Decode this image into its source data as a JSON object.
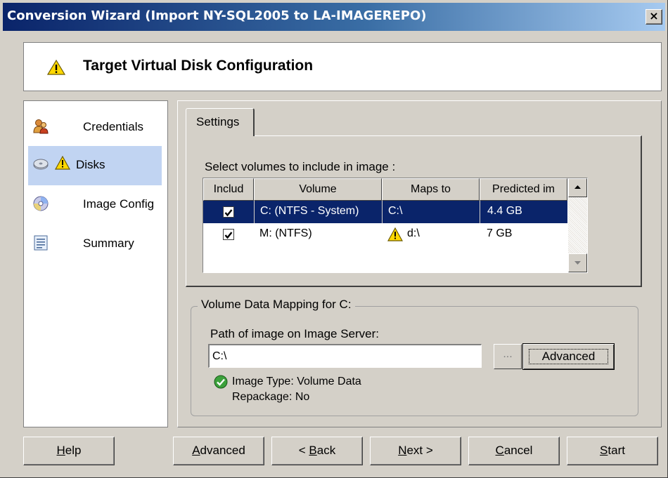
{
  "window": {
    "title": "Conversion Wizard (Import NY-SQL2005 to LA-IMAGEREPO)",
    "close_label": "×"
  },
  "header": {
    "title": "Target Virtual Disk Configuration",
    "icon": "warning-icon"
  },
  "nav": {
    "items": [
      {
        "label": "Credentials",
        "icon": "users-icon",
        "selected": false,
        "warning": false
      },
      {
        "label": "Disks",
        "icon": "disk-icon",
        "selected": true,
        "warning": true
      },
      {
        "label": "Image Config",
        "icon": "cd-icon",
        "selected": false,
        "warning": false
      },
      {
        "label": "Summary",
        "icon": "document-icon",
        "selected": false,
        "warning": false
      }
    ]
  },
  "tabs": [
    {
      "label": "Settings",
      "active": true
    }
  ],
  "volumes": {
    "caption": "Select volumes to include in image :",
    "columns": [
      "Includ",
      "Volume",
      "Maps to",
      "Predicted im"
    ],
    "rows": [
      {
        "included": true,
        "volume": "C: (NTFS - System)",
        "maps_to": "C:\\",
        "predicted": "4.4 GB",
        "selected": true,
        "warning": false
      },
      {
        "included": true,
        "volume": "M: (NTFS)",
        "maps_to": "d:\\",
        "predicted": "7 GB",
        "selected": false,
        "warning": true
      }
    ]
  },
  "mapping": {
    "group_label": "Volume Data Mapping for C:",
    "path_label": "Path of image on Image Server:",
    "path_value": "C:\\",
    "browse_label": "...",
    "advanced_label": "Advanced",
    "image_type": "Image Type: Volume Data",
    "repackage": "Repackage: No"
  },
  "buttons": {
    "help": {
      "pre": "",
      "key": "H",
      "post": "elp"
    },
    "advanced": {
      "pre": "",
      "key": "A",
      "post": "dvanced"
    },
    "back": {
      "pre": "< ",
      "key": "B",
      "post": "ack"
    },
    "next": {
      "pre": "",
      "key": "N",
      "post": "ext >"
    },
    "cancel": {
      "pre": "",
      "key": "C",
      "post": "ancel"
    },
    "start": {
      "pre": "",
      "key": "S",
      "post": "tart"
    }
  },
  "colors": {
    "title_gradient_start": "#0a246a",
    "title_gradient_end": "#a6caf0",
    "selection": "#0a246a",
    "nav_selection": "#c1d4f2",
    "dialog_face": "#d4d0c8"
  }
}
